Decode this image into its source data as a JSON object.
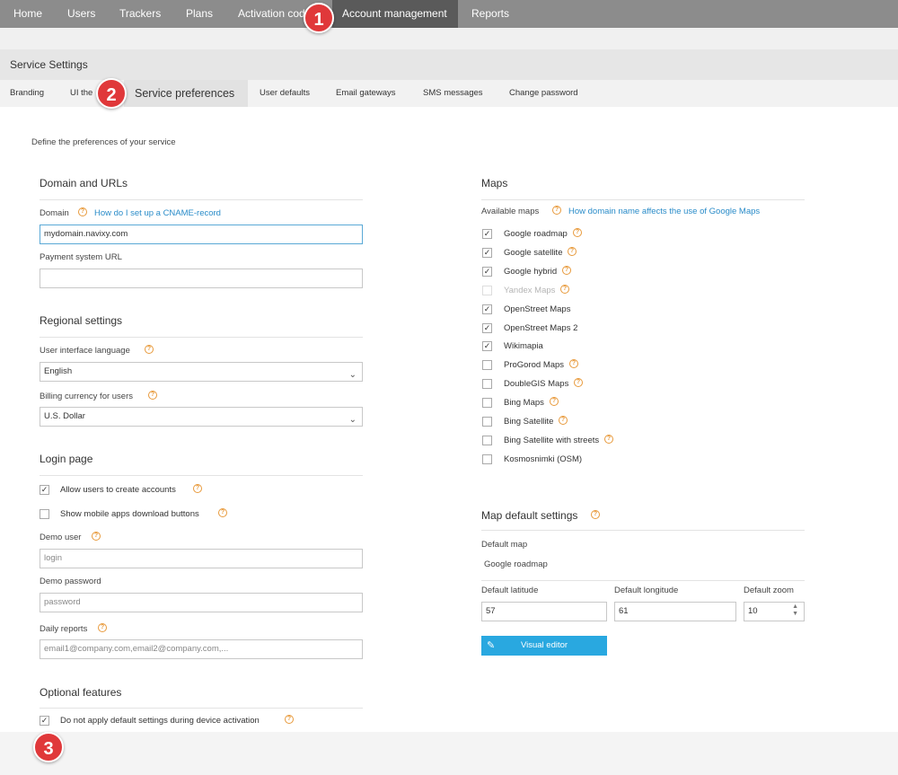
{
  "nav": {
    "home": "Home",
    "users": "Users",
    "trackers": "Trackers",
    "plans": "Plans",
    "activation": "Activation cod",
    "account": "Account management",
    "reports": "Reports"
  },
  "page_title": "Service Settings",
  "subtabs": {
    "branding": "Branding",
    "ui_themes": "UI the",
    "service_prefs": "Service preferences",
    "user_defaults": "User defaults",
    "email_gateways": "Email gateways",
    "sms_messages": "SMS messages",
    "change_password": "Change password"
  },
  "intro": "Define the preferences of your service",
  "domain_section": {
    "title": "Domain and URLs",
    "domain_label": "Domain",
    "domain_help_link": "How do I set up a CNAME-record",
    "domain_value": "mydomain.navixy.com",
    "payment_label": "Payment system URL",
    "payment_value": ""
  },
  "regional_section": {
    "title": "Regional settings",
    "language_label": "User interface language",
    "language_value": "English",
    "currency_label": "Billing currency for users",
    "currency_value": "U.S. Dollar"
  },
  "login_section": {
    "title": "Login page",
    "allow_create": "Allow users to create accounts",
    "allow_create_checked": true,
    "show_mobile": "Show mobile apps download buttons",
    "show_mobile_checked": false,
    "demo_user_label": "Demo user",
    "demo_user_placeholder": "login",
    "demo_password_label": "Demo password",
    "demo_password_placeholder": "password",
    "daily_reports_label": "Daily reports",
    "daily_reports_placeholder": "email1@company.com,email2@company.com,..."
  },
  "optional_section": {
    "title": "Optional features",
    "no_default": "Do not apply default settings during device activation",
    "no_default_checked": true
  },
  "maps_section": {
    "title": "Maps",
    "available_label": "Available maps",
    "available_help_link": "How domain name affects the use of Google Maps",
    "maps": [
      {
        "label": "Google roadmap",
        "checked": true,
        "disabled": false,
        "help": true
      },
      {
        "label": "Google satellite",
        "checked": true,
        "disabled": false,
        "help": true
      },
      {
        "label": "Google hybrid",
        "checked": true,
        "disabled": false,
        "help": true
      },
      {
        "label": "Yandex Maps",
        "checked": false,
        "disabled": true,
        "help": true
      },
      {
        "label": "OpenStreet Maps",
        "checked": true,
        "disabled": false,
        "help": false
      },
      {
        "label": "OpenStreet Maps 2",
        "checked": true,
        "disabled": false,
        "help": false
      },
      {
        "label": "Wikimapia",
        "checked": true,
        "disabled": false,
        "help": false
      },
      {
        "label": "ProGorod Maps",
        "checked": false,
        "disabled": false,
        "help": true
      },
      {
        "label": "DoubleGIS Maps",
        "checked": false,
        "disabled": false,
        "help": true
      },
      {
        "label": "Bing Maps",
        "checked": false,
        "disabled": false,
        "help": true
      },
      {
        "label": "Bing Satellite",
        "checked": false,
        "disabled": false,
        "help": true
      },
      {
        "label": "Bing Satellite with streets",
        "checked": false,
        "disabled": false,
        "help": true
      },
      {
        "label": "Kosmosnimki (OSM)",
        "checked": false,
        "disabled": false,
        "help": false
      }
    ]
  },
  "map_defaults": {
    "title": "Map default settings",
    "default_map_label": "Default map",
    "default_map_value": "Google roadmap",
    "lat_label": "Default latitude",
    "lat_value": "57",
    "lon_label": "Default longitude",
    "lon_value": "61",
    "zoom_label": "Default zoom",
    "zoom_value": "10",
    "visual_editor": "Visual editor"
  },
  "help_glyph": "?",
  "check_glyph": "✓",
  "badges": [
    "1",
    "2",
    "3"
  ],
  "colors": {
    "accent_blue": "#29a8e0",
    "link_blue": "#2a8cc9",
    "help_orange": "#e89a3c",
    "badge_red": "#e0383a",
    "nav_gray": "#8c8c8c",
    "nav_active": "#5a5a5a"
  }
}
